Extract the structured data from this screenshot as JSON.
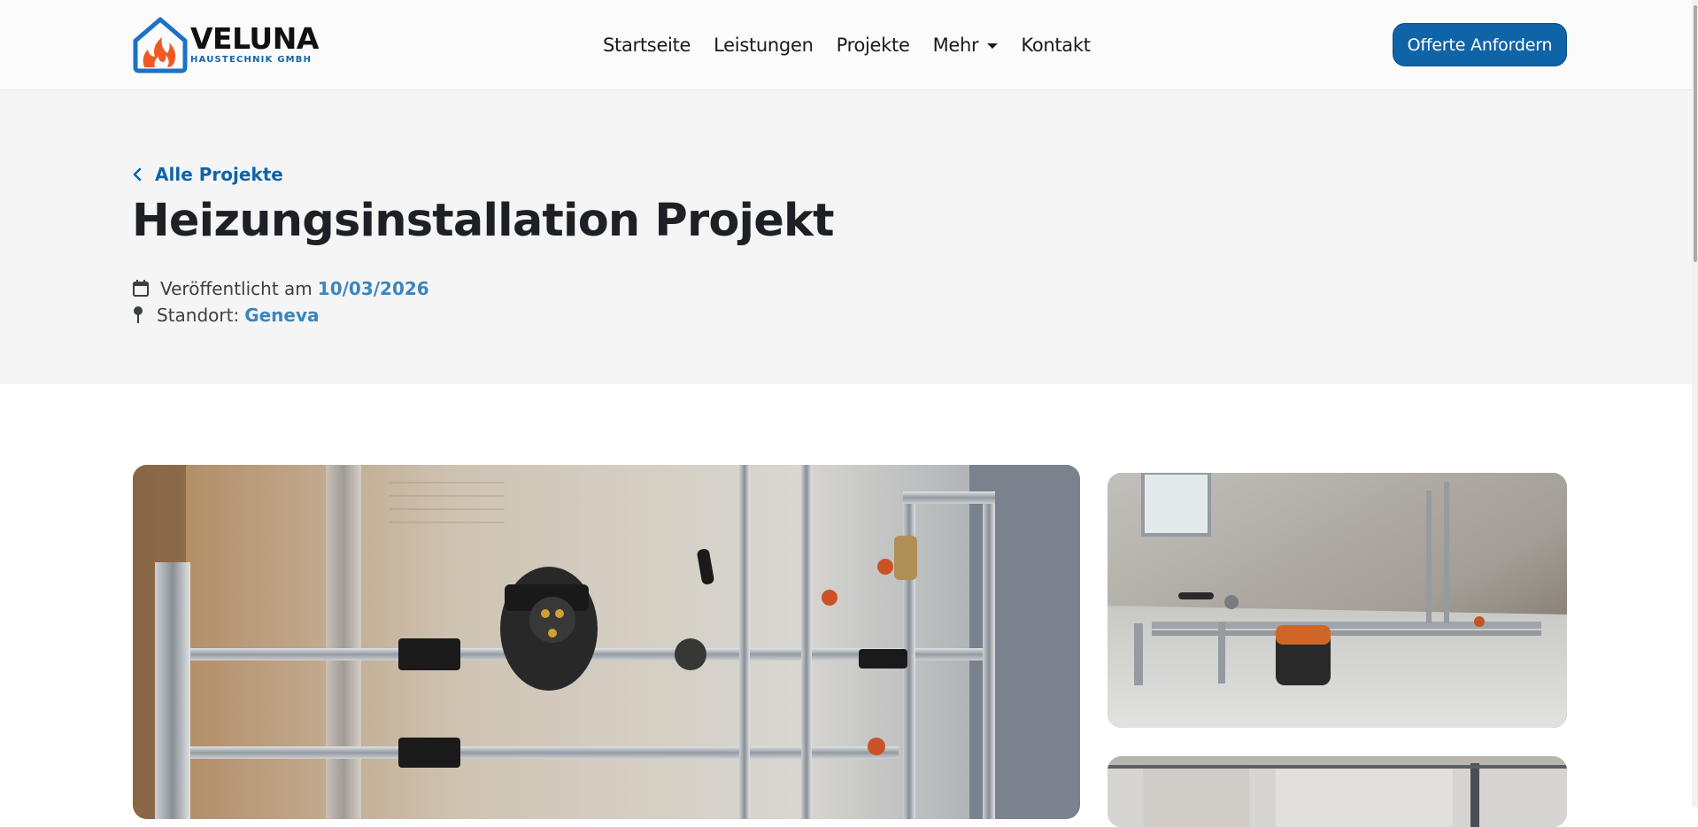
{
  "brand": {
    "name": "VELUNA",
    "tagline": "HAUSTECHNIK GMBH",
    "primary_color": "#0f64a8",
    "accent_color": "#f05a22"
  },
  "nav": {
    "items": [
      {
        "label": "Startseite"
      },
      {
        "label": "Leistungen"
      },
      {
        "label": "Projekte"
      },
      {
        "label": "Mehr"
      },
      {
        "label": "Kontakt"
      }
    ],
    "cta_label": "Offerte Anfordern"
  },
  "hero": {
    "back_label": "Alle Projekte",
    "title": "Heizungsinstallation Projekt",
    "published_prefix": "Veröffentlicht am",
    "published_date": "10/03/2026",
    "location_prefix": "Standort:",
    "location": "Geneva"
  },
  "icons": {
    "back": "chevron-left-icon",
    "calendar": "calendar-icon",
    "location": "map-pin-icon",
    "dropdown": "caret-down-icon"
  }
}
